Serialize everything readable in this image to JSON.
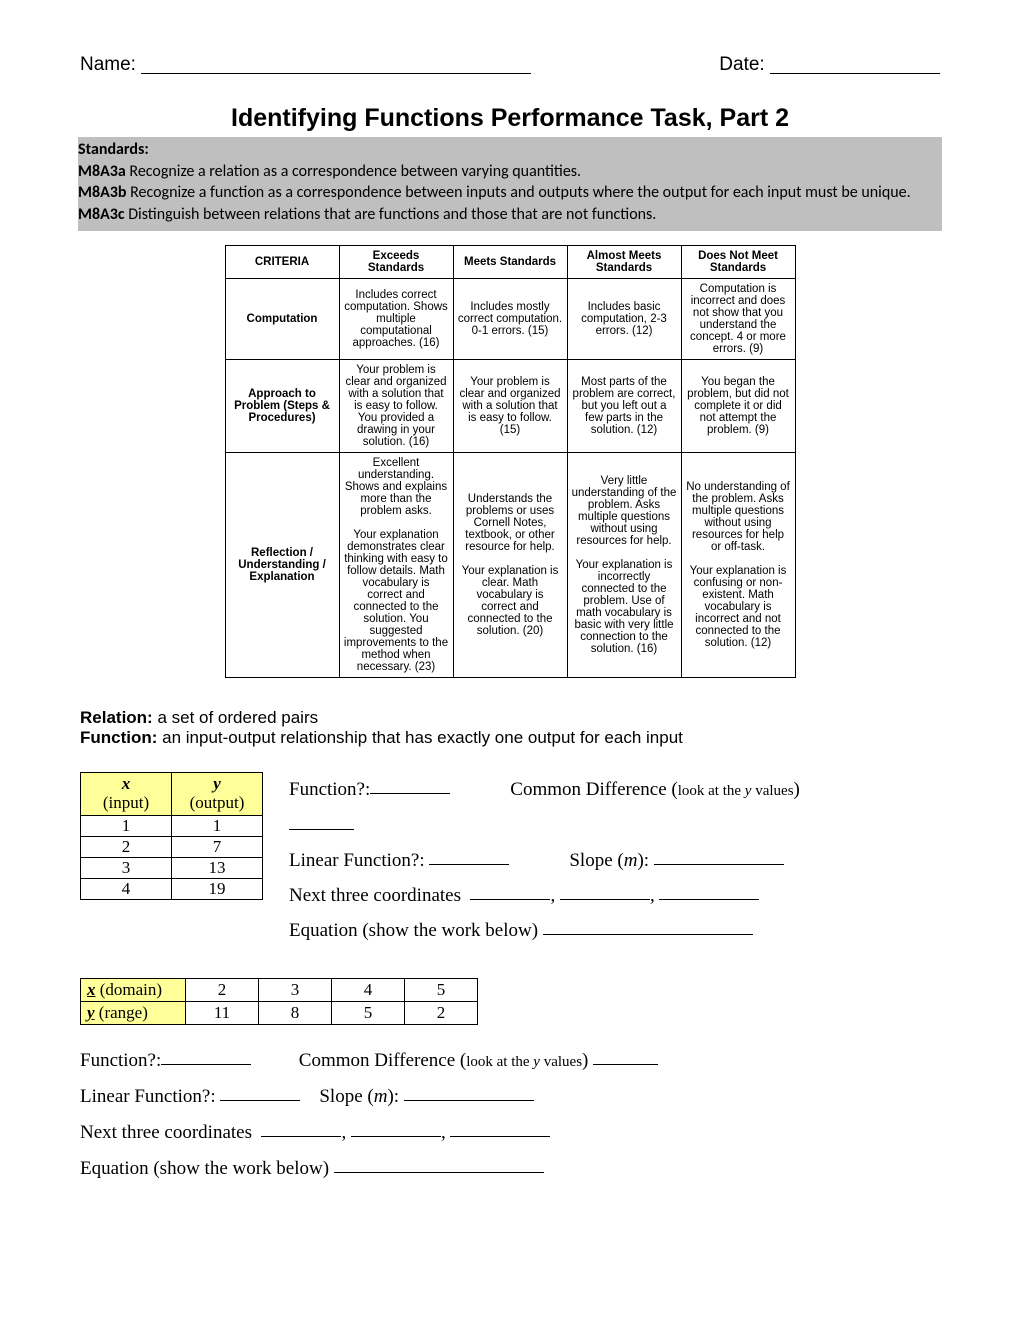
{
  "header": {
    "name_label": "Name:",
    "date_label": "Date:"
  },
  "title": "Identifying Functions Performance Task, Part 2",
  "standards": {
    "heading": "Standards:",
    "items": [
      {
        "code": "M8A3a",
        "text": " Recognize a relation as a correspondence between varying quantities."
      },
      {
        "code": "M8A3b",
        "text": " Recognize a function as a correspondence between inputs and outputs where the output for each input must be unique."
      },
      {
        "code": "M8A3c",
        "text": " Distinguish between relations that are functions and those that are not functions."
      }
    ]
  },
  "rubric": {
    "headers": [
      "CRITERIA",
      "Exceeds Standards",
      "Meets Standards",
      "Almost Meets Standards",
      "Does Not Meet Standards"
    ],
    "rows": [
      {
        "criteria": "Computation",
        "cells": [
          "Includes correct computation. Shows multiple computational approaches. (16)",
          "Includes mostly correct computation. 0-1 errors. (15)",
          "Includes basic computation, 2-3 errors. (12)",
          "Computation is incorrect and does not show that you understand the concept. 4 or more errors. (9)"
        ]
      },
      {
        "criteria": "Approach to Problem (Steps & Procedures)",
        "cells": [
          "Your problem is clear and organized with a solution that is easy to follow. You provided a drawing in your solution. (16)",
          "Your problem is clear and organized with a solution that is easy to follow. (15)",
          "Most parts of the problem are correct, but you left out a few parts in the solution. (12)",
          "You began the problem, but did not complete it or did not attempt the problem. (9)"
        ]
      },
      {
        "criteria": "Reflection / Understanding / Explanation",
        "cells": [
          "Excellent understanding. Shows and explains more than the problem asks.\n\nYour explanation demonstrates clear thinking with easy to follow details. Math vocabulary is correct and connected to the solution. You suggested improvements to the method when necessary. (23)",
          "Understands the problems or uses Cornell Notes, textbook, or other resource for help.\n\nYour explanation is clear. Math vocabulary is correct and connected to the solution. (20)",
          "Very little understanding of the problem. Asks multiple questions without using resources for help.\n\nYour explanation is incorrectly connected to the problem. Use of math vocabulary is basic with very little connection to the solution. (16)",
          "No understanding of the problem. Asks multiple questions without using resources for help or off-task.\n\nYour explanation is confusing or non-existent. Math vocabulary is incorrect and not connected to the solution. (12)"
        ]
      }
    ]
  },
  "definitions": [
    {
      "term": "Relation:",
      "def": " a set of ordered pairs"
    },
    {
      "term": "Function:",
      "def": " an input-output relationship that has exactly one output for each input"
    }
  ],
  "table1": {
    "x_header_var": "x",
    "x_header_sub": "(input)",
    "y_header_var": "y",
    "y_header_sub": "(output)",
    "rows": [
      {
        "x": "1",
        "y": "1"
      },
      {
        "x": "2",
        "y": "7"
      },
      {
        "x": "3",
        "y": "13"
      },
      {
        "x": "4",
        "y": "19"
      }
    ]
  },
  "questions": {
    "function": "Function?:",
    "common_diff": "Common Difference (",
    "common_diff_small": "look at the ",
    "common_diff_y": "y",
    "common_diff_small2": " values",
    "common_diff_close": ")",
    "linear": "Linear Function?:",
    "slope": "Slope (",
    "slope_m": "m",
    "slope_close": "):",
    "next_three": "Next three coordinates",
    "equation": "Equation (show the work below)"
  },
  "table2": {
    "x_header_var": "x",
    "x_header_label": " (domain)",
    "y_header_var": "y",
    "y_header_label": " (range)",
    "x_vals": [
      "2",
      "3",
      "4",
      "5"
    ],
    "y_vals": [
      "11",
      "8",
      "5",
      "2"
    ]
  }
}
